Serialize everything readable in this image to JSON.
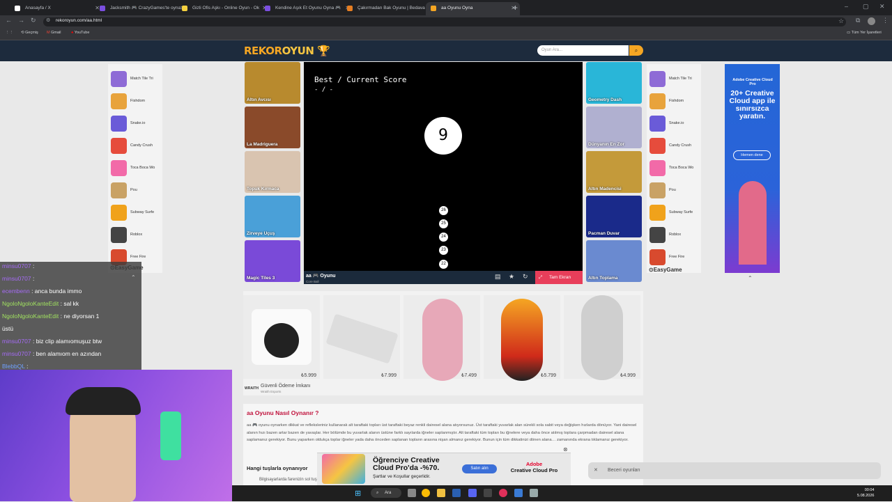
{
  "browser": {
    "tabs": [
      {
        "label": "Anasayfa / X",
        "color": "#ffffff"
      },
      {
        "label": "Jacksmith 🎮 CrazyGames'te oyna",
        "color": "#7b4fe0"
      },
      {
        "label": "Gizli Ofis Aşkı - Online Oyun - Ok",
        "color": "#f4d03f"
      },
      {
        "label": "Kendine Aşık Et Oyunu Oyna 🎮",
        "color": "#7b4fe0"
      },
      {
        "label": "Çakırmadan Bak Oyunu | Bedava",
        "color": "#e67e22"
      },
      {
        "label": "aa Oyunu Oyna",
        "color": "#f5a623"
      }
    ],
    "url": "rekoroyun.com/aa.html",
    "bookmarks": [
      "Geçmiş",
      "Gmail",
      "YouTube"
    ],
    "all_bookmarks": "Tüm Yer İşaretleri"
  },
  "site": {
    "logo_a": "REKOR",
    "logo_b": "OYUN",
    "search_placeholder": "Oyun Ara...",
    "search_icon": "search-icon"
  },
  "left_list": [
    {
      "label": "Match Tile Tri",
      "color": "#8e6bd6"
    },
    {
      "label": "Fishdom",
      "color": "#e8a33c"
    },
    {
      "label": "Snake.io",
      "color": "#6a5bd8"
    },
    {
      "label": "Candy Crush",
      "color": "#e64c3c"
    },
    {
      "label": "Toca Boca Wo",
      "color": "#f26aa8"
    },
    {
      "label": "Pou",
      "color": "#c9a265"
    },
    {
      "label": "Subway Surfe",
      "color": "#f0a21b"
    },
    {
      "label": "Roblox",
      "color": "#444444"
    },
    {
      "label": "Free Fire",
      "color": "#d84a2e"
    }
  ],
  "right_list": [
    {
      "label": "Match Tile Tri",
      "color": "#8e6bd6"
    },
    {
      "label": "Fishdom",
      "color": "#e8a33c"
    },
    {
      "label": "Snake.io",
      "color": "#6a5bd8"
    },
    {
      "label": "Candy Crush",
      "color": "#e64c3c"
    },
    {
      "label": "Toca Boca Wo",
      "color": "#f26aa8"
    },
    {
      "label": "Pou",
      "color": "#c9a265"
    },
    {
      "label": "Subway Surfe",
      "color": "#f0a21b"
    },
    {
      "label": "Roblox",
      "color": "#444444"
    },
    {
      "label": "Free Fire",
      "color": "#d84a2e"
    }
  ],
  "easygame": "EasyGame",
  "left_games": [
    {
      "label": "Altın Avcısı",
      "color": "#b88a2e"
    },
    {
      "label": "La Madriguera",
      "color": "#8a4a2a"
    },
    {
      "label": "Topuk Kırmaca",
      "color": "#d9c4b0"
    },
    {
      "label": "Zirveye Uçuş",
      "color": "#4aa0d8"
    },
    {
      "label": "Magic Tiles 3",
      "color": "#7a4ad8"
    }
  ],
  "right_games": [
    {
      "label": "Geometry Dash",
      "color": "#29b6d8"
    },
    {
      "label": "Dünyanın En Zor",
      "color": "#b0b0d0"
    },
    {
      "label": "Altın Madencisi",
      "color": "#c49a3a"
    },
    {
      "label": "Pacman Duvar",
      "color": "#1a2a8a"
    },
    {
      "label": "Altın Toplama",
      "color": "#6a8ad0"
    }
  ],
  "game": {
    "score_label": "Best / Current Score",
    "score_value": "- / -",
    "center_number": "9",
    "pins": [
      "26",
      "25",
      "24",
      "23",
      "22"
    ],
    "title": "aa 🎮 Oyunu",
    "subtitle": "Core Ball",
    "fullscreen": "Tam Ekran"
  },
  "ad_right": {
    "brand": "Adobe Creative Cloud Pro",
    "headline": "20+ Creative Cloud app ile sınırsızca yaratın.",
    "button": "Hemen dene"
  },
  "products": {
    "prices": [
      "₺5.999",
      "₺7.999",
      "₺7.499",
      "₺5.799",
      "₺4.999"
    ],
    "secure": "Güvenli Ödeme İmkanı",
    "secure_sub": "Wraith Esports",
    "watermark": "WRAITH"
  },
  "article": {
    "heading": "aa Oyunu Nasıl Oynanır ?",
    "para": "aa 🎮 oyunu oynarken dikkat ve refleksleriniz kullanarak alt taraftaki topları üst taraftaki beyaz renkli dairesel alana atıyorsunuz. Üst taraftaki yuvarlak alan sürekli sola sabit veya değişken hızlarda dönüyor. Yani dairesel alanın hızı bazen artar bazen de yavaşlar. Her bölümde bu yuvarlak alanın üstüne farklı sayılarda iğneler saplanmıştır. Alt taraftaki tüm topları bu iğnelere veya daha önce atılmış toplara çarpmadan dairesel alana saplamanız gerekiyor. Bunu yaparken oldukça toplar iğneler yada daha önceden saplanan topların arasına nişan almanız gerekiyor. Bunun için tüm dikkatinizi dönen alana… zamanında ekrana tıklamanız gerekiyor.",
    "heading2": "Hangi tuşlarla oynanıyor",
    "bullet": "Bilgisayarlarda farenizin sol tuşu… yukarı doğru atıyorsunuz."
  },
  "chat": [
    {
      "user": "minsu0707",
      "text": "",
      "cls": "u1"
    },
    {
      "user": "minsu0707",
      "text": "",
      "cls": "u1"
    },
    {
      "user": "ecembenn",
      "text": "anca bunda immo",
      "cls": "u1"
    },
    {
      "user": "NgoloNgoloKanteEdit",
      "text": "sal kk",
      "cls": "u2"
    },
    {
      "user": "NgoloNgoloKanteEdit",
      "text": "ne diyorsan 1",
      "cls": "u2"
    },
    {
      "user": "",
      "text": "üstü",
      "cls": "u2"
    },
    {
      "user": "minsu0707",
      "text": "biz clip alamıomuşuz btw",
      "cls": "u1"
    },
    {
      "user": "minsu0707",
      "text": "ben alamıom en azından",
      "cls": "u1"
    },
    {
      "user": "BlebbQL",
      "text": "",
      "cls": "u3"
    }
  ],
  "bottom_ad": {
    "headline": "Öğrenciye Creative Cloud Pro'da -%70.",
    "sub": "Şartlar ve Koşullar geçerlidir.",
    "button": "Satın alın",
    "brand_a": "Adobe",
    "brand_b": "Creative Cloud Pro"
  },
  "notification": "Beceri oyunları",
  "taskbar": {
    "search": "Ara",
    "time": "00:04",
    "date": "5.08.2026"
  }
}
